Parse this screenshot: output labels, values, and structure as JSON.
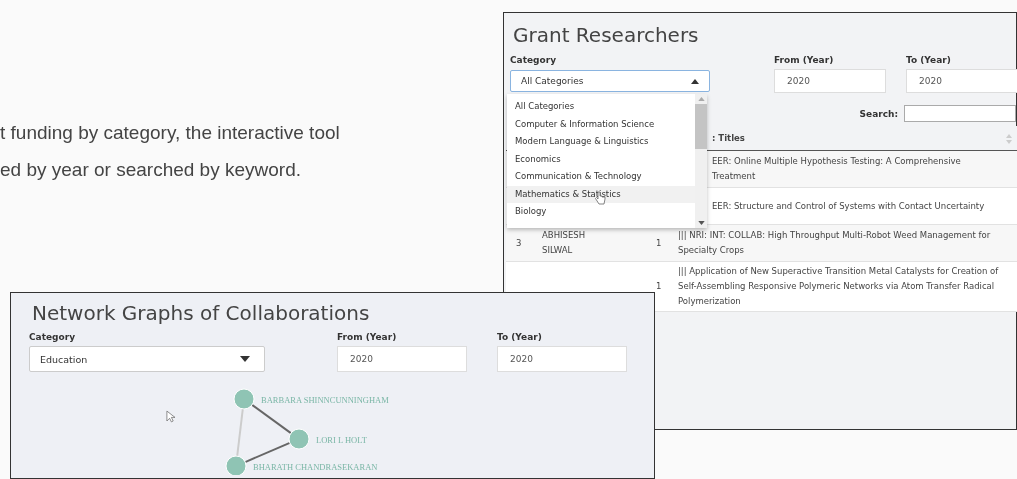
{
  "intro": {
    "lines": [
      "t funding by category, the interactive tool",
      "ed by year or searched by keyword."
    ]
  },
  "grant_panel": {
    "title": "Grant Researchers",
    "category": {
      "label": "Category",
      "value": "All Categories",
      "expanded": true,
      "options": [
        {
          "label": "All Categories",
          "hovered": false
        },
        {
          "label": "Computer & Information Science",
          "hovered": false
        },
        {
          "label": "Modern Language & Linguistics",
          "hovered": false
        },
        {
          "label": "Economics",
          "hovered": false
        },
        {
          "label": "Communication & Technology",
          "hovered": false
        },
        {
          "label": "Mathematics & Statistics",
          "hovered": true
        },
        {
          "label": "Biology",
          "hovered": false
        }
      ]
    },
    "from_year": {
      "label": "From (Year)",
      "value": "2020"
    },
    "to_year": {
      "label": "To (Year)",
      "value": "2020"
    },
    "search": {
      "label": "Search:"
    },
    "table": {
      "columns": [
        "",
        "",
        "",
        ": Titles"
      ],
      "rows": [
        [
          "",
          "",
          "",
          "EER: Online Multiple Hypothesis Testing: A Comprehensive Treatment"
        ],
        [
          "",
          "",
          "",
          "EER: Structure and Control of Systems with Contact Uncertainty"
        ],
        [
          "3",
          "ABHISESH SILWAL",
          "1",
          "||| NRI: INT: COLLAB: High Throughput Multi-Robot Weed Management for Specialty Crops"
        ],
        [
          "",
          "",
          "1",
          "||| Application of New Superactive Transition Metal Catalysts for Creation of Self-Assembling Responsive Polymeric Networks via Atom Transfer Radical Polymerization"
        ]
      ]
    }
  },
  "network_panel": {
    "title": "Network Graphs of Collaborations",
    "category": {
      "label": "Category",
      "value": "Education",
      "expanded": false
    },
    "from_year": {
      "label": "From (Year)",
      "value": "2020"
    },
    "to_year": {
      "label": "To (Year)",
      "value": "2020"
    },
    "graph": {
      "nodes": [
        {
          "label": "BARBARA SHINNCUNNINGHAM"
        },
        {
          "label": "LORI L HOLT"
        },
        {
          "label": "BHARATH CHANDRASEKARAN"
        }
      ]
    }
  }
}
